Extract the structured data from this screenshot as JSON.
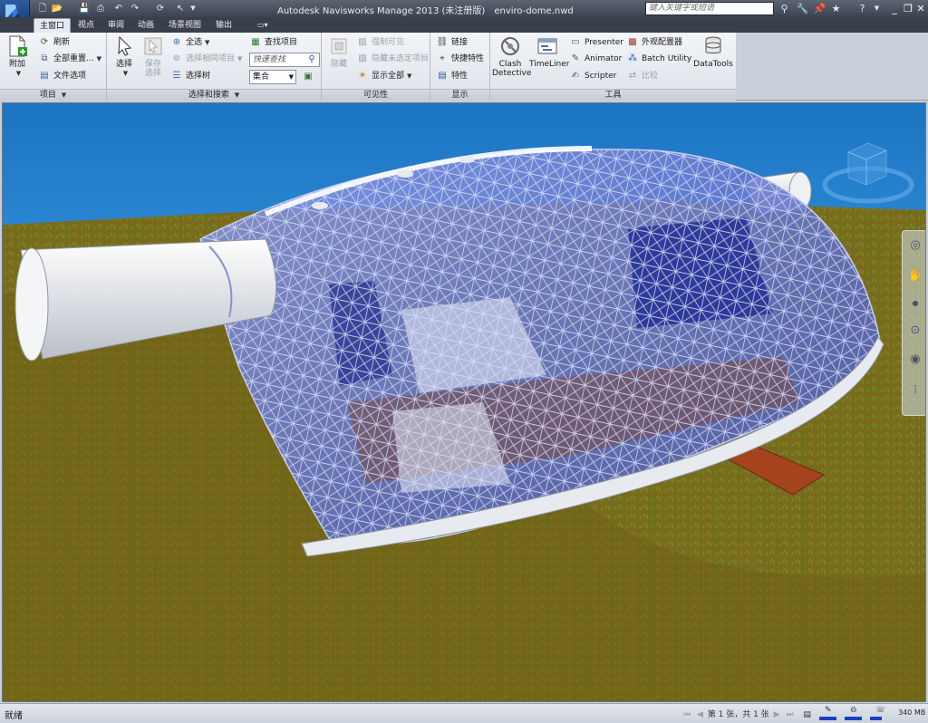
{
  "window": {
    "title": "Autodesk Navisworks Manage 2013 (未注册版)",
    "file": "enviro-dome.nwd",
    "search_placeholder": "键入关键字或短语"
  },
  "icons": {
    "app_menu": "navisworks-logo-icon",
    "quick_access": [
      "new-icon",
      "open-icon",
      "save-icon",
      "print-icon",
      "undo-icon",
      "redo-icon",
      "refresh-icon",
      "select-icon",
      "customize-icon"
    ],
    "title_right": [
      "binoculars-icon",
      "wrench-icon",
      "pin-icon",
      "star-icon",
      "help-icon"
    ]
  },
  "tabs": [
    "主窗口",
    "视点",
    "审阅",
    "动画",
    "场景视图",
    "输出"
  ],
  "ribbon": {
    "project": {
      "label": "项目",
      "add": "附加",
      "refresh": "刷新",
      "reset_all": "全部重置...",
      "file_options": "文件选项"
    },
    "select_search": {
      "label": "选择和搜索",
      "select": "选择",
      "save_selection": "保存选择",
      "select_all": "全选",
      "select_same": "选择相同项目",
      "selection_tree": "选择树",
      "find_items": "查找项目",
      "quick_find_placeholder": "快速查找",
      "sets": "集合"
    },
    "visibility": {
      "label": "可见性",
      "hide": "隐藏",
      "require": "强制可见",
      "hide_unselected": "隐藏未选定项目",
      "unhide_all": "显示全部"
    },
    "display": {
      "label": "显示",
      "links": "链接",
      "quick_props": "快捷特性",
      "properties": "特性"
    },
    "tools": {
      "label": "工具",
      "clash": "Clash Detective",
      "timeliner": "TimeLiner",
      "presenter": "Presenter",
      "animator": "Animator",
      "scripter": "Scripter",
      "appearance": "外观配置器",
      "batch": "Batch Utility",
      "compare": "比较",
      "datatools": "DataTools"
    }
  },
  "status": {
    "text": "就绪",
    "sheet": "第 1 张，共 1 张",
    "memory": "340 MB",
    "meters": [
      0.85,
      0.85,
      0.6
    ]
  },
  "colors": {
    "sky": "#1f7bc9",
    "ground": "#7a6a1c",
    "dome_glass": "#6d7ed0",
    "accent_blue": "#1b3fc7"
  }
}
